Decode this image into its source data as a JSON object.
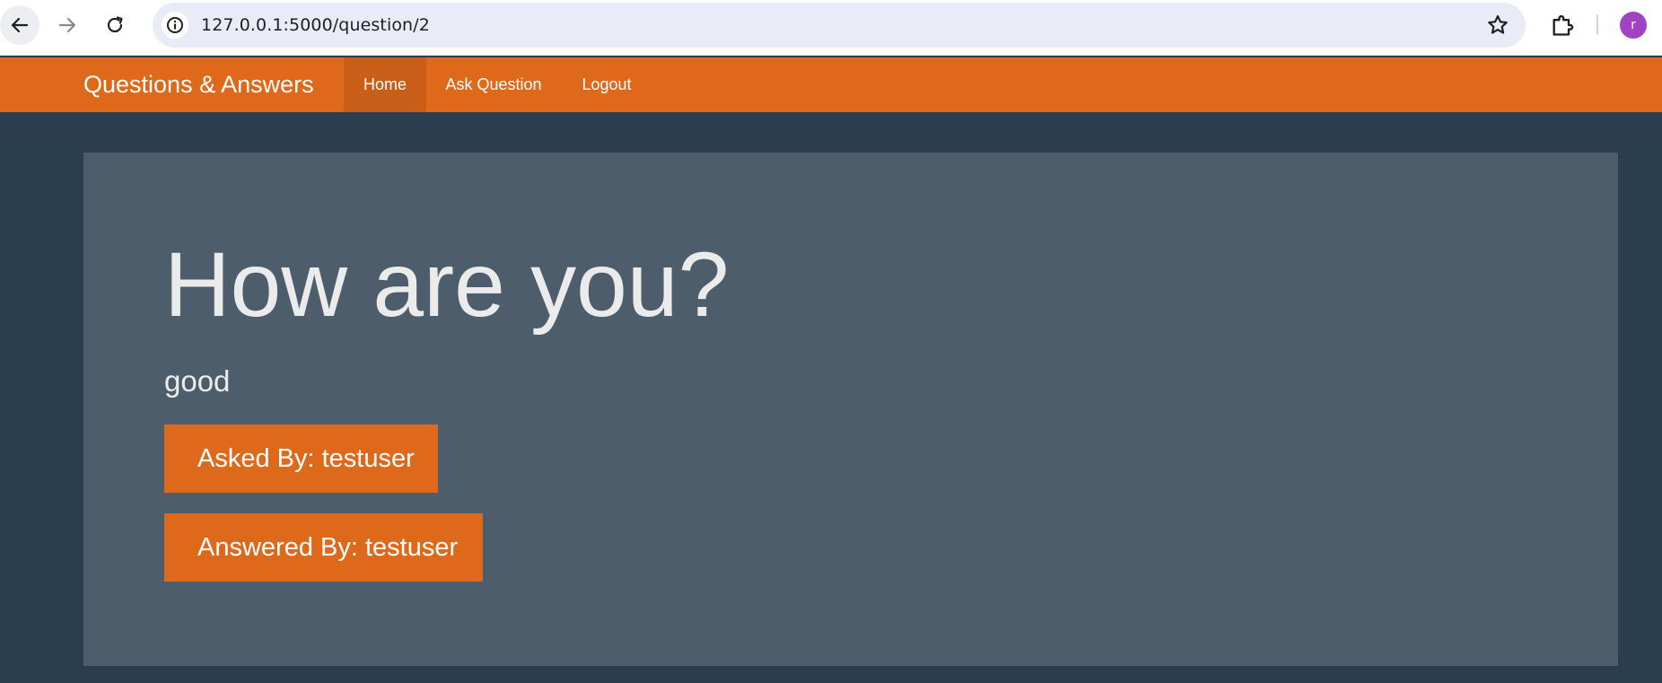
{
  "browser": {
    "url": "127.0.0.1:5000/question/2",
    "profile_initial": "r"
  },
  "navbar": {
    "brand": "Questions & Answers",
    "items": [
      {
        "label": "Home",
        "active": true
      },
      {
        "label": "Ask Question",
        "active": false
      },
      {
        "label": "Logout",
        "active": false
      }
    ]
  },
  "question": {
    "title": "How are you?",
    "answer": "good",
    "asked_by": "Asked By: testuser",
    "answered_by": "Answered By: testuser"
  },
  "colors": {
    "accent": "#df691a",
    "background": "#2b3e50",
    "panel": "#4e5d6c"
  }
}
